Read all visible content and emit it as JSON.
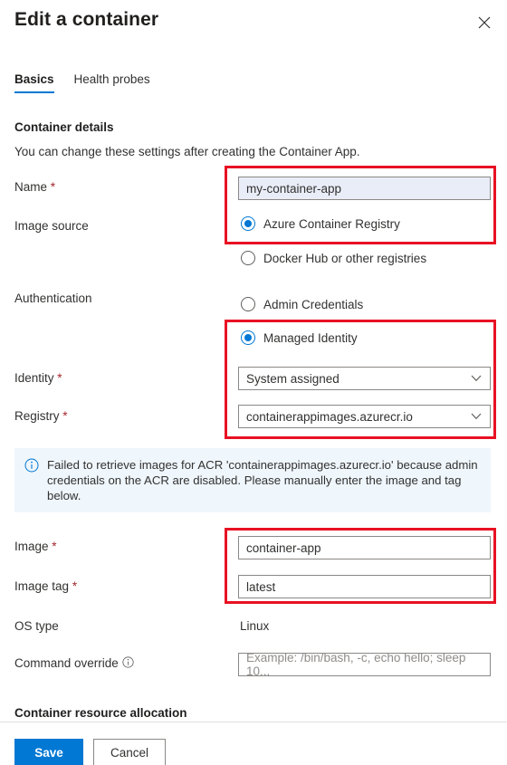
{
  "header": {
    "title": "Edit a container",
    "close_icon": "close-icon"
  },
  "tabs": [
    {
      "label": "Basics",
      "active": true
    },
    {
      "label": "Health probes",
      "active": false
    }
  ],
  "section": {
    "heading": "Container details",
    "description": "You can change these settings after creating the Container App."
  },
  "fields": {
    "name": {
      "label": "Name",
      "required": "*",
      "value": "my-container-app",
      "readonly": true
    },
    "image_source": {
      "label": "Image source",
      "options": [
        {
          "label": "Azure Container Registry",
          "checked": true
        },
        {
          "label": "Docker Hub or other registries",
          "checked": false
        }
      ]
    },
    "authentication": {
      "label": "Authentication",
      "options": [
        {
          "label": "Admin Credentials",
          "checked": false
        },
        {
          "label": "Managed Identity",
          "checked": true
        }
      ]
    },
    "identity": {
      "label": "Identity",
      "required": "*",
      "value": "System assigned",
      "chevron_icon": "chevron-down-icon"
    },
    "registry": {
      "label": "Registry",
      "required": "*",
      "value": "containerappimages.azurecr.io",
      "chevron_icon": "chevron-down-icon"
    },
    "image": {
      "label": "Image",
      "required": "*",
      "value": "container-app"
    },
    "image_tag": {
      "label": "Image tag",
      "required": "*",
      "value": "latest"
    },
    "os_type": {
      "label": "OS type",
      "value": "Linux"
    },
    "command_override": {
      "label": "Command override",
      "info_icon": "info-circle-icon",
      "placeholder": "Example: /bin/bash, -c, echo hello; sleep 10..."
    }
  },
  "banner": {
    "icon": "info-circle-icon",
    "message": "Failed to retrieve images for ACR 'containerappimages.azurecr.io' because admin credentials on the ACR are disabled. Please manually enter the image and tag below.",
    "background": "#eff6fc",
    "accent": "#0078d4"
  },
  "resource_section": {
    "heading": "Container resource allocation"
  },
  "footer": {
    "save_label": "Save",
    "cancel_label": "Cancel",
    "primary_color": "#0078d4"
  },
  "annotations": {
    "color": "#e81123",
    "boxes": [
      {
        "name": "name-and-image-source-highlight"
      },
      {
        "name": "managed-identity-registry-highlight"
      },
      {
        "name": "image-and-tag-highlight"
      }
    ]
  }
}
